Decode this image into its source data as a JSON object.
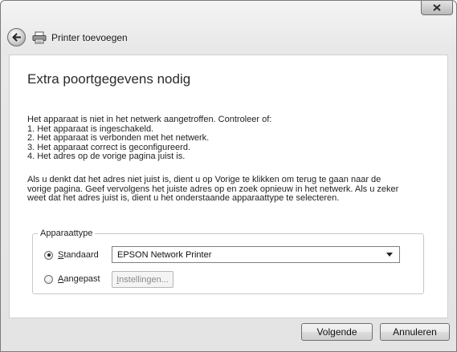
{
  "window": {
    "title": "Printer toevoegen"
  },
  "heading": "Extra poortgegevens nodig",
  "intro": "Het apparaat is niet in het netwerk aangetroffen. Controleer of:",
  "checklist": [
    "1. Het apparaat is ingeschakeld.",
    "2. Het apparaat is verbonden met het netwerk.",
    "3. Het apparaat correct is geconfigureerd.",
    "4. Het adres op de vorige pagina juist is."
  ],
  "paragraph": [
    "Als u denkt dat het adres niet juist is, dient u op Vorige te klikken om terug te gaan naar de",
    "vorige pagina. Geef vervolgens het juiste adres op en zoek opnieuw in het netwerk. Als u zeker",
    "weet dat het adres juist is, dient u het onderstaande apparaattype te selecteren."
  ],
  "device_type": {
    "legend": "Apparaattype",
    "standard": {
      "accel": "S",
      "rest": "tandaard",
      "selected": true
    },
    "custom": {
      "accel": "A",
      "rest": "angepast",
      "selected": false
    },
    "select_value": "EPSON Network Printer",
    "settings": {
      "accel": "I",
      "rest": "nstellingen..."
    }
  },
  "buttons": {
    "next": "Volgende",
    "cancel": "Annuleren"
  }
}
